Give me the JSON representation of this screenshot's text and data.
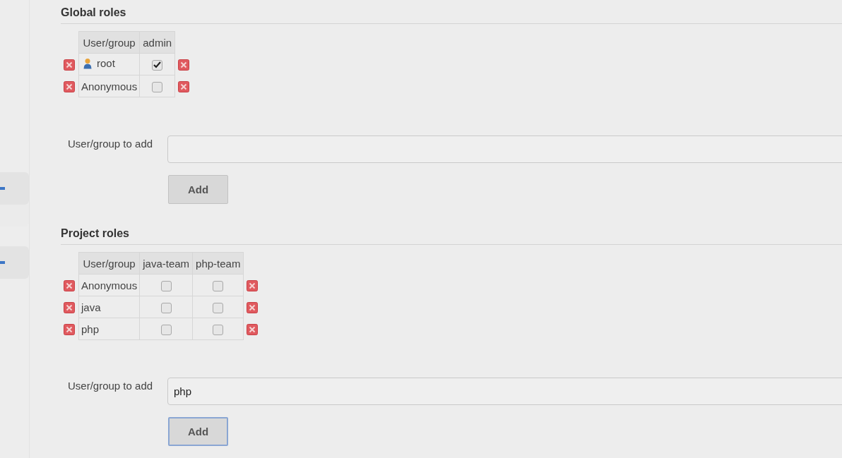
{
  "sections": [
    {
      "title": "Global roles",
      "columns": [
        "User/group",
        "admin"
      ],
      "rows": [
        {
          "name": "root",
          "kind": "user",
          "checked": [
            true
          ]
        },
        {
          "name": "Anonymous",
          "kind": "plain",
          "checked": [
            false
          ]
        }
      ],
      "add_field": {
        "label": "User/group to add"
      },
      "add_button": {
        "label": "Add",
        "focused": false
      }
    },
    {
      "title": "Project roles",
      "columns": [
        "User/group",
        "java-team",
        "php-team"
      ],
      "rows": [
        {
          "name": "Anonymous",
          "kind": "plain",
          "checked": [
            false,
            false
          ]
        },
        {
          "name": "java",
          "kind": "plain",
          "checked": [
            false,
            false
          ]
        },
        {
          "name": "php",
          "kind": "plain",
          "checked": [
            false,
            false
          ]
        }
      ],
      "add_field": {
        "label": "User/group to add",
        "value": "php"
      },
      "add_button": {
        "label": "Add",
        "focused": true
      }
    }
  ]
}
